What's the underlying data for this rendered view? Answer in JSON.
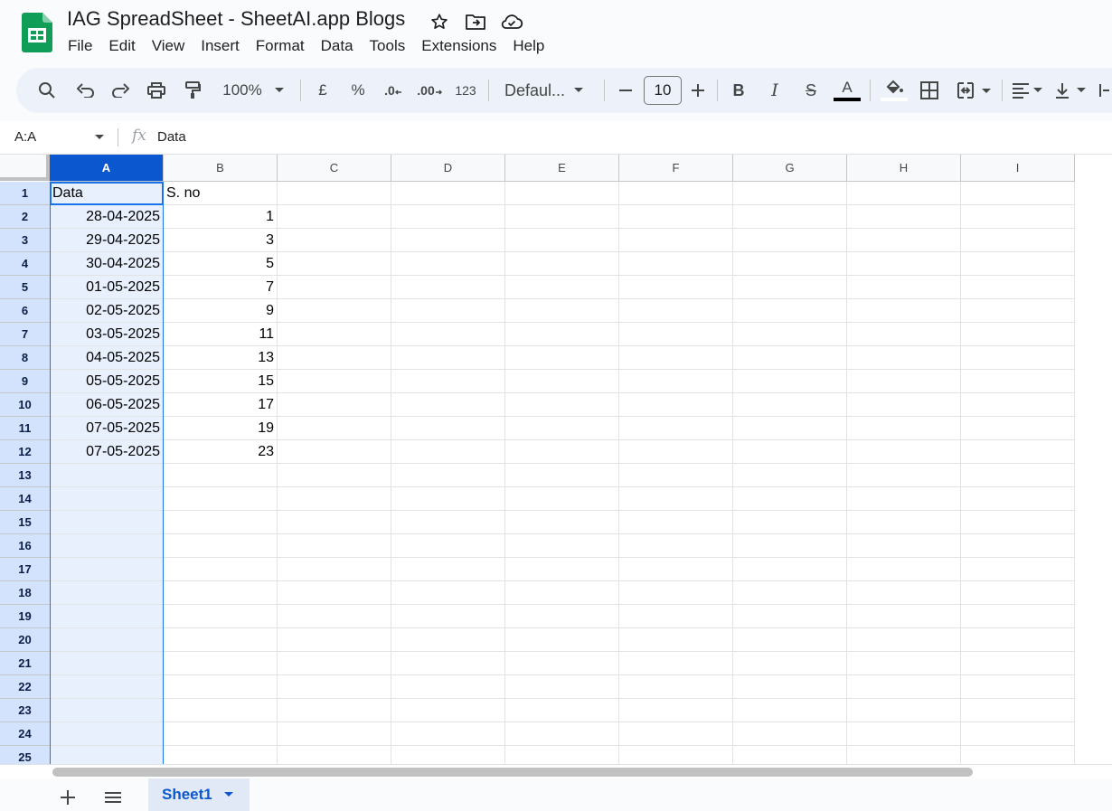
{
  "app": {
    "title": "IAG SpreadSheet - SheetAI.app Blogs",
    "menu": [
      "File",
      "Edit",
      "View",
      "Insert",
      "Format",
      "Data",
      "Tools",
      "Extensions",
      "Help"
    ]
  },
  "toolbar": {
    "zoom": "100%",
    "currency": "£",
    "percent": "%",
    "decimal_decrease": ".0",
    "decimal_increase": ".00",
    "number_format": "123",
    "font": "Defaul...",
    "font_size": "10",
    "text_color_bar": "#000000",
    "fill_color_bar": "#ffffff"
  },
  "formula_bar": {
    "name_box": "A:A",
    "fx": "fx",
    "value": "Data"
  },
  "columns": [
    "A",
    "B",
    "C",
    "D",
    "E",
    "F",
    "G",
    "H",
    "I"
  ],
  "rows": [
    "1",
    "2",
    "3",
    "4",
    "5",
    "6",
    "7",
    "8",
    "9",
    "10",
    "11",
    "12",
    "13",
    "14",
    "15",
    "16",
    "17",
    "18",
    "19",
    "20",
    "21",
    "22",
    "23",
    "24",
    "25"
  ],
  "cells": {
    "A": [
      "Data",
      "28-04-2025",
      "29-04-2025",
      "30-04-2025",
      "01-05-2025",
      "02-05-2025",
      "03-05-2025",
      "04-05-2025",
      "05-05-2025",
      "06-05-2025",
      "07-05-2025",
      "07-05-2025"
    ],
    "B": [
      "S. no",
      "1",
      "3",
      "5",
      "7",
      "9",
      "11",
      "13",
      "15",
      "17",
      "19",
      "23"
    ]
  },
  "sheets": {
    "active": "Sheet1"
  },
  "colors": {
    "selected_header": "#0b57d0",
    "selected_column_fill": "#e8f0fe",
    "row_header_selected": "#d3e3fd",
    "sheets_green": "#0f9d58"
  }
}
